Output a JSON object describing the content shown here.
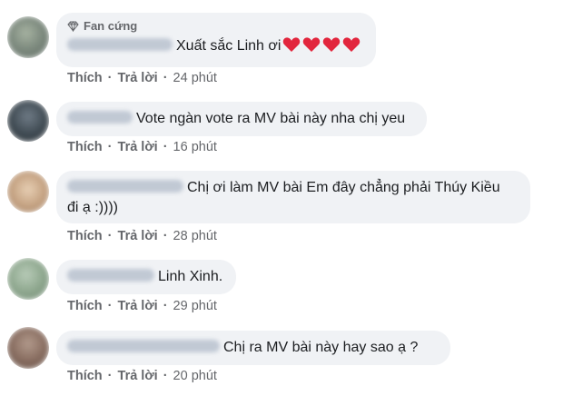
{
  "colors": {
    "bubble": "#f0f2f5",
    "meta": "#65676b",
    "text": "#1c1e21",
    "heart": "#e2263d"
  },
  "comments": [
    {
      "badge": "Fan cứng",
      "badge_icon": "diamond-icon",
      "text": "Xuất sắc Linh ơi",
      "emoji": [
        "heart",
        "heart",
        "heart",
        "heart"
      ],
      "like": "Thích",
      "reply": "Trả lời",
      "time": "24 phút"
    },
    {
      "text": "Vote ngàn vote ra MV bài này nha chị yeu",
      "like": "Thích",
      "reply": "Trả lời",
      "time": "16 phút"
    },
    {
      "text_line1": "Chị ơi làm MV bài Em đây chẳng phải Thúy Kiều",
      "text_line2": "đi ạ :))))",
      "like": "Thích",
      "reply": "Trả lời",
      "time": "28 phút"
    },
    {
      "text": "Linh Xinh.",
      "like": "Thích",
      "reply": "Trả lời",
      "time": "29 phút"
    },
    {
      "text": "Chị ra MV bài này hay sao ạ ?",
      "like": "Thích",
      "reply": "Trả lời",
      "time": "20 phút"
    }
  ]
}
